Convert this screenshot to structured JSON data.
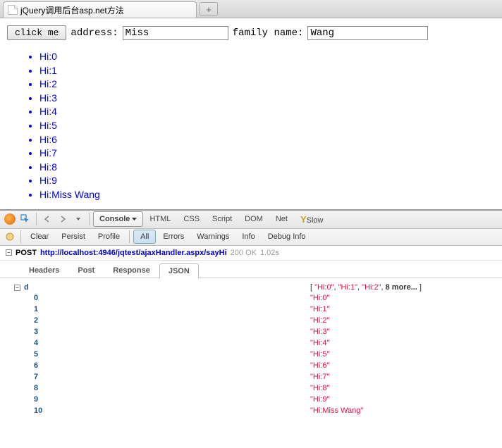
{
  "tab": {
    "title": "jQuery调用后台asp.net方法"
  },
  "form": {
    "button_label": "click me",
    "address_label": "address:",
    "address_value": "Miss",
    "family_label": "family name:",
    "family_value": "Wang"
  },
  "results": [
    "Hi:0",
    "Hi:1",
    "Hi:2",
    "Hi:3",
    "Hi:4",
    "Hi:5",
    "Hi:6",
    "Hi:7",
    "Hi:8",
    "Hi:9",
    "Hi:Miss Wang"
  ],
  "firebug": {
    "tabs": {
      "console": "Console",
      "html": "HTML",
      "css": "CSS",
      "script": "Script",
      "dom": "DOM",
      "net": "Net",
      "yslow": "YSlow"
    },
    "subtabs": {
      "clear": "Clear",
      "persist": "Persist",
      "profile": "Profile",
      "all": "All",
      "errors": "Errors",
      "warnings": "Warnings",
      "info": "Info",
      "debug": "Debug Info"
    },
    "request": {
      "method": "POST",
      "url": "http://localhost:4946/jqtest/ajaxHandler.aspx/sayHi",
      "status": "200 OK",
      "time": "1.02s",
      "response_tabs": {
        "headers": "Headers",
        "post": "Post",
        "response": "Response",
        "json": "JSON"
      }
    },
    "json": {
      "root_key": "d",
      "preview_open": "[ ",
      "preview_items": [
        "\"Hi:0\"",
        "\"Hi:1\"",
        "\"Hi:2\""
      ],
      "preview_sep": ", ",
      "preview_more": "8 more...",
      "preview_close": " ]",
      "rows": [
        {
          "k": "0",
          "v": "\"Hi:0\""
        },
        {
          "k": "1",
          "v": "\"Hi:1\""
        },
        {
          "k": "2",
          "v": "\"Hi:2\""
        },
        {
          "k": "3",
          "v": "\"Hi:3\""
        },
        {
          "k": "4",
          "v": "\"Hi:4\""
        },
        {
          "k": "5",
          "v": "\"Hi:5\""
        },
        {
          "k": "6",
          "v": "\"Hi:6\""
        },
        {
          "k": "7",
          "v": "\"Hi:7\""
        },
        {
          "k": "8",
          "v": "\"Hi:8\""
        },
        {
          "k": "9",
          "v": "\"Hi:9\""
        },
        {
          "k": "10",
          "v": "\"Hi:Miss Wang\""
        }
      ]
    }
  }
}
